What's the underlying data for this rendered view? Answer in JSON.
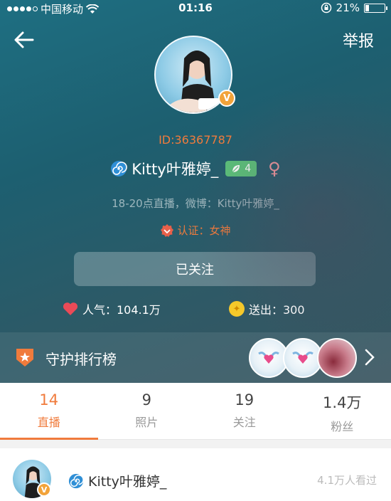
{
  "status_bar": {
    "carrier": "中国移动",
    "time": "01:16",
    "battery": "21%",
    "battery_level": 0.21
  },
  "nav": {
    "report": "举报"
  },
  "profile": {
    "id": "ID:36367787",
    "name": "Kitty叶雅婷_",
    "level": "4",
    "bio": "18-20点直播，微博：Kitty叶雅婷_",
    "cert": "认证：女神",
    "follow_label": "已关注",
    "popularity": "人气：104.1万",
    "sent": "送出：300"
  },
  "rank": {
    "label": "守护排行榜"
  },
  "tabs": [
    {
      "count": "14",
      "label": "直播"
    },
    {
      "count": "9",
      "label": "照片"
    },
    {
      "count": "19",
      "label": "关注"
    },
    {
      "count": "1.4万",
      "label": "粉丝"
    }
  ],
  "list": [
    {
      "name": "Kitty叶雅婷_",
      "meta": "4.1万人看过"
    }
  ],
  "colors": {
    "accent": "#f07b3c",
    "level_green": "#5bc27a",
    "verified": "#f2a33a"
  }
}
